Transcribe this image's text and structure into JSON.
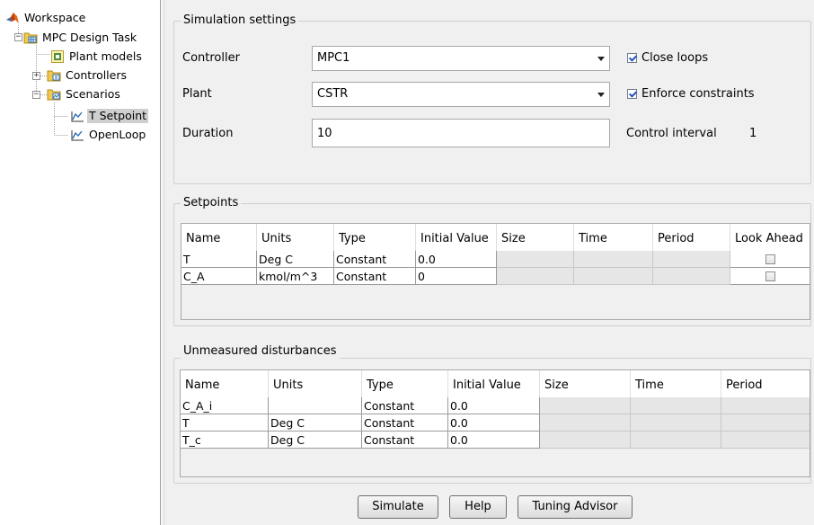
{
  "tree": {
    "workspace": "Workspace",
    "task": "MPC Design Task",
    "plant_models": "Plant models",
    "controllers": "Controllers",
    "scenarios": "Scenarios",
    "t_setpoint": "T Setpoint",
    "openloop": "OpenLoop"
  },
  "sim": {
    "title": "Simulation settings",
    "controller_label": "Controller",
    "controller_value": "MPC1",
    "plant_label": "Plant",
    "plant_value": "CSTR",
    "duration_label": "Duration",
    "duration_value": "10",
    "close_loops": "Close loops",
    "close_loops_checked": true,
    "enforce_constraints": "Enforce constraints",
    "enforce_constraints_checked": true,
    "control_interval_label": "Control interval",
    "control_interval_value": "1"
  },
  "setpoints": {
    "title": "Setpoints",
    "headers": [
      "Name",
      "Units",
      "Type",
      "Initial Value",
      "Size",
      "Time",
      "Period",
      "Look Ahead"
    ],
    "rows": [
      [
        "T",
        "Deg C",
        "Constant",
        "0.0",
        "",
        "",
        "",
        ""
      ],
      [
        "C_A",
        "kmol/m^3",
        "Constant",
        "0",
        "",
        "",
        "",
        ""
      ]
    ]
  },
  "disturbances": {
    "title": "Unmeasured disturbances",
    "headers": [
      "Name",
      "Units",
      "Type",
      "Initial Value",
      "Size",
      "Time",
      "Period"
    ],
    "rows": [
      [
        "C_A_i",
        "",
        "Constant",
        "0.0",
        "",
        "",
        ""
      ],
      [
        "T",
        "Deg C",
        "Constant",
        "0.0",
        "",
        "",
        ""
      ],
      [
        "T_c",
        "Deg C",
        "Constant",
        "0.0",
        "",
        "",
        ""
      ]
    ]
  },
  "buttons": {
    "simulate": "Simulate",
    "help": "Help",
    "tuning_advisor": "Tuning Advisor"
  }
}
